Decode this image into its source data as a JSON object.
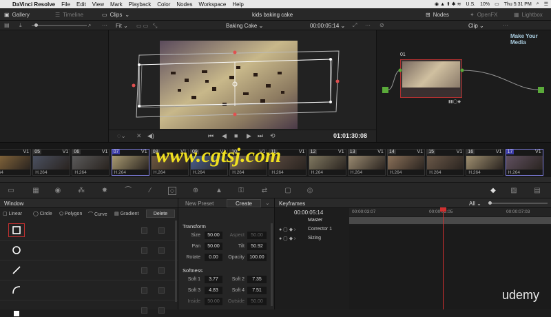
{
  "menubar": {
    "app": "DaVinci Resolve",
    "items": [
      "File",
      "Edit",
      "View",
      "Mark",
      "Playback",
      "Color",
      "Nodes",
      "Workspace",
      "Help"
    ],
    "lang": "U.S.",
    "battery": "10%",
    "clock": "Thu 5:31 PM"
  },
  "topbar": {
    "gallery": "Gallery",
    "timeline": "Timeline",
    "clips": "Clips",
    "project": "kids baking cake",
    "nodes": "Nodes",
    "openfx": "OpenFX",
    "lightbox": "Lightbox"
  },
  "viewer": {
    "fit": "Fit",
    "clip_name": "Baking Cake",
    "timecode": "00:00:05:14",
    "playhead_tc": "01:01:30:08"
  },
  "nodepanel": {
    "mode": "Clip",
    "node_label": "01",
    "watermark": "Make Your Media"
  },
  "timeline": {
    "clips": [
      {
        "num": "",
        "v": "V1",
        "fmt": "264",
        "color": "#8a6a3c"
      },
      {
        "num": "05",
        "v": "V1",
        "fmt": "H.264",
        "color": "#4a5060"
      },
      {
        "num": "06",
        "v": "V1",
        "fmt": "H.264",
        "color": "#5a5a5a"
      },
      {
        "num": "07",
        "v": "V1",
        "fmt": "H.264",
        "color": "#a89a70",
        "sel": true
      },
      {
        "num": "08",
        "v": "V1",
        "fmt": "H.264",
        "color": "#6d5840"
      },
      {
        "num": "09",
        "v": "V1",
        "fmt": "H.264",
        "color": "#4a6090"
      },
      {
        "num": "10",
        "v": "V1",
        "fmt": "H.264",
        "color": "#7a6a58"
      },
      {
        "num": "11",
        "v": "V1",
        "fmt": "H.264",
        "color": "#5a4a40"
      },
      {
        "num": "12",
        "v": "V1",
        "fmt": "H.264",
        "color": "#807860"
      },
      {
        "num": "13",
        "v": "V1",
        "fmt": "H.264",
        "color": "#9a8a70"
      },
      {
        "num": "14",
        "v": "V1",
        "fmt": "H.264",
        "color": "#8a7058"
      },
      {
        "num": "15",
        "v": "V1",
        "fmt": "H.264",
        "color": "#6a5848"
      },
      {
        "num": "16",
        "v": "V1",
        "fmt": "H.264",
        "color": "#a09070"
      },
      {
        "num": "17",
        "v": "V1",
        "fmt": "H.264",
        "color": "#605060",
        "sel": true
      }
    ],
    "watermark": "www.cgtsj.com"
  },
  "window": {
    "title": "Window",
    "tools": [
      "Linear",
      "Circle",
      "Polygon",
      "Curve",
      "Gradient"
    ],
    "delete": "Delete",
    "new_preset": "New Preset",
    "create": "Create"
  },
  "transform": {
    "title": "Transform",
    "size_label": "Size",
    "size": "50.00",
    "aspect_label": "Aspect",
    "aspect": "50.00",
    "pan_label": "Pan",
    "pan": "50.00",
    "tilt_label": "Tilt",
    "tilt": "50.92",
    "rotate_label": "Rotate",
    "rotate": "0.00",
    "opacity_label": "Opacity",
    "opacity": "100.00"
  },
  "softness": {
    "title": "Softness",
    "s1_label": "Soft 1",
    "s1": "3.77",
    "s2_label": "Soft 2",
    "s2": "7.35",
    "s3_label": "Soft 3",
    "s3": "4.83",
    "s4_label": "Soft 4",
    "s4": "7.51",
    "inside_label": "Inside",
    "inside": "50.00",
    "outside_label": "Outside",
    "outside": "50.00"
  },
  "keyframes": {
    "title": "Keyframes",
    "filter": "All",
    "timecode": "00:00:05:14",
    "ruler": [
      "00:00:03:07",
      "00:00:05:05",
      "00:00:07:03"
    ],
    "master": "Master",
    "tracks": [
      "Corrector 1",
      "Sizing"
    ],
    "watermark": "udemy"
  }
}
